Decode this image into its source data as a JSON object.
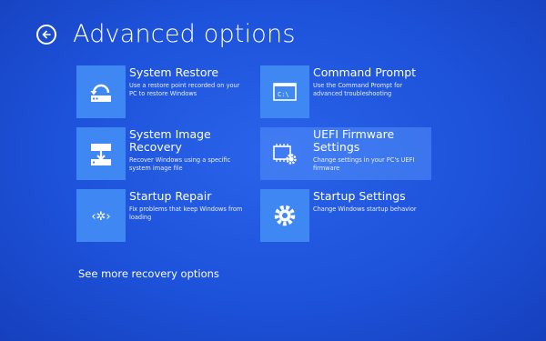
{
  "header": {
    "title": "Advanced options"
  },
  "tiles": [
    {
      "label": "System Restore",
      "description": "Use a restore point recorded on your PC to restore Windows",
      "icon": "system-restore-icon"
    },
    {
      "label": "Command Prompt",
      "description": "Use the Command Prompt for advanced troubleshooting",
      "icon": "command-prompt-icon",
      "icon_text": "C:\\"
    },
    {
      "label": "System Image Recovery",
      "description": "Recover Windows using a specific system image file",
      "icon": "system-image-recovery-icon"
    },
    {
      "label": "UEFI Firmware Settings",
      "description": "Change settings in your PC's UEFI firmware",
      "icon": "uefi-firmware-icon",
      "selected": true
    },
    {
      "label": "Startup Repair",
      "description": "Fix problems that keep Windows from loading",
      "icon": "startup-repair-icon",
      "icon_text": "‹✲›"
    },
    {
      "label": "Startup Settings",
      "description": "Change Windows startup behavior",
      "icon": "startup-settings-gear-icon"
    }
  ],
  "footer": {
    "more_link": "See more recovery options"
  },
  "colors": {
    "background": "#1d52da",
    "tile_icon_bg": "#3f88f4",
    "selected_tile_bg": "#5e9cff",
    "text": "#ffffff"
  }
}
